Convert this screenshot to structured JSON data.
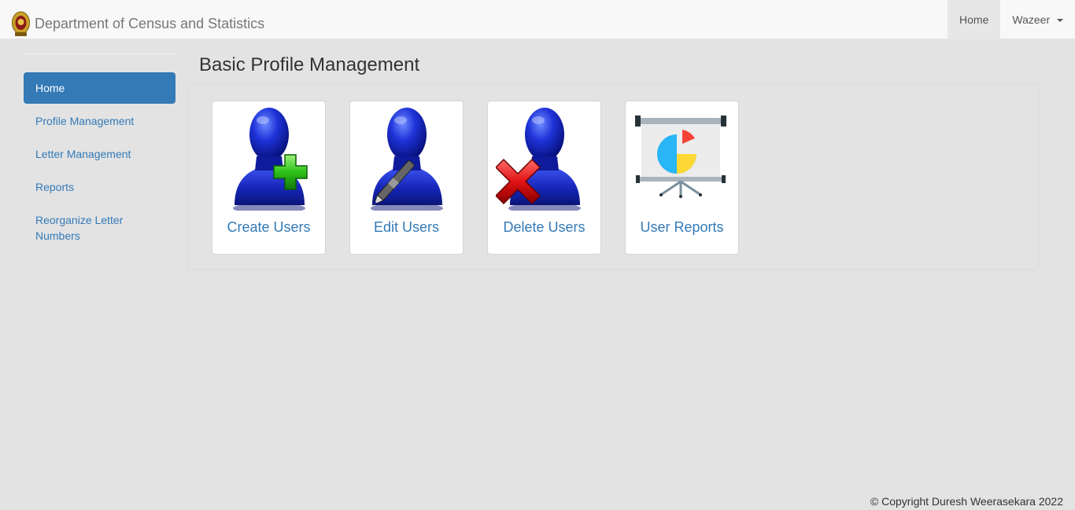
{
  "navbar": {
    "brand_text": "Department of Census and Statistics",
    "home_label": "Home",
    "user_label": "Wazeer"
  },
  "sidebar": {
    "items": [
      {
        "label": "Home"
      },
      {
        "label": "Profile Management"
      },
      {
        "label": "Letter Management"
      },
      {
        "label": "Reports"
      },
      {
        "label": "Reorganize Letter Numbers"
      }
    ]
  },
  "main": {
    "title": "Basic Profile Management",
    "tiles": [
      {
        "label": "Create Users",
        "icon": "user-add-icon"
      },
      {
        "label": "Edit Users",
        "icon": "user-edit-icon"
      },
      {
        "label": "Delete Users",
        "icon": "user-delete-icon"
      },
      {
        "label": "User Reports",
        "icon": "presentation-chart-icon"
      }
    ]
  },
  "footer": {
    "copyright": "© Copyright Duresh Weerasekara 2022"
  },
  "colors": {
    "accent": "#337ab7",
    "background": "#e3e3e3",
    "navbar": "#f8f8f8"
  }
}
